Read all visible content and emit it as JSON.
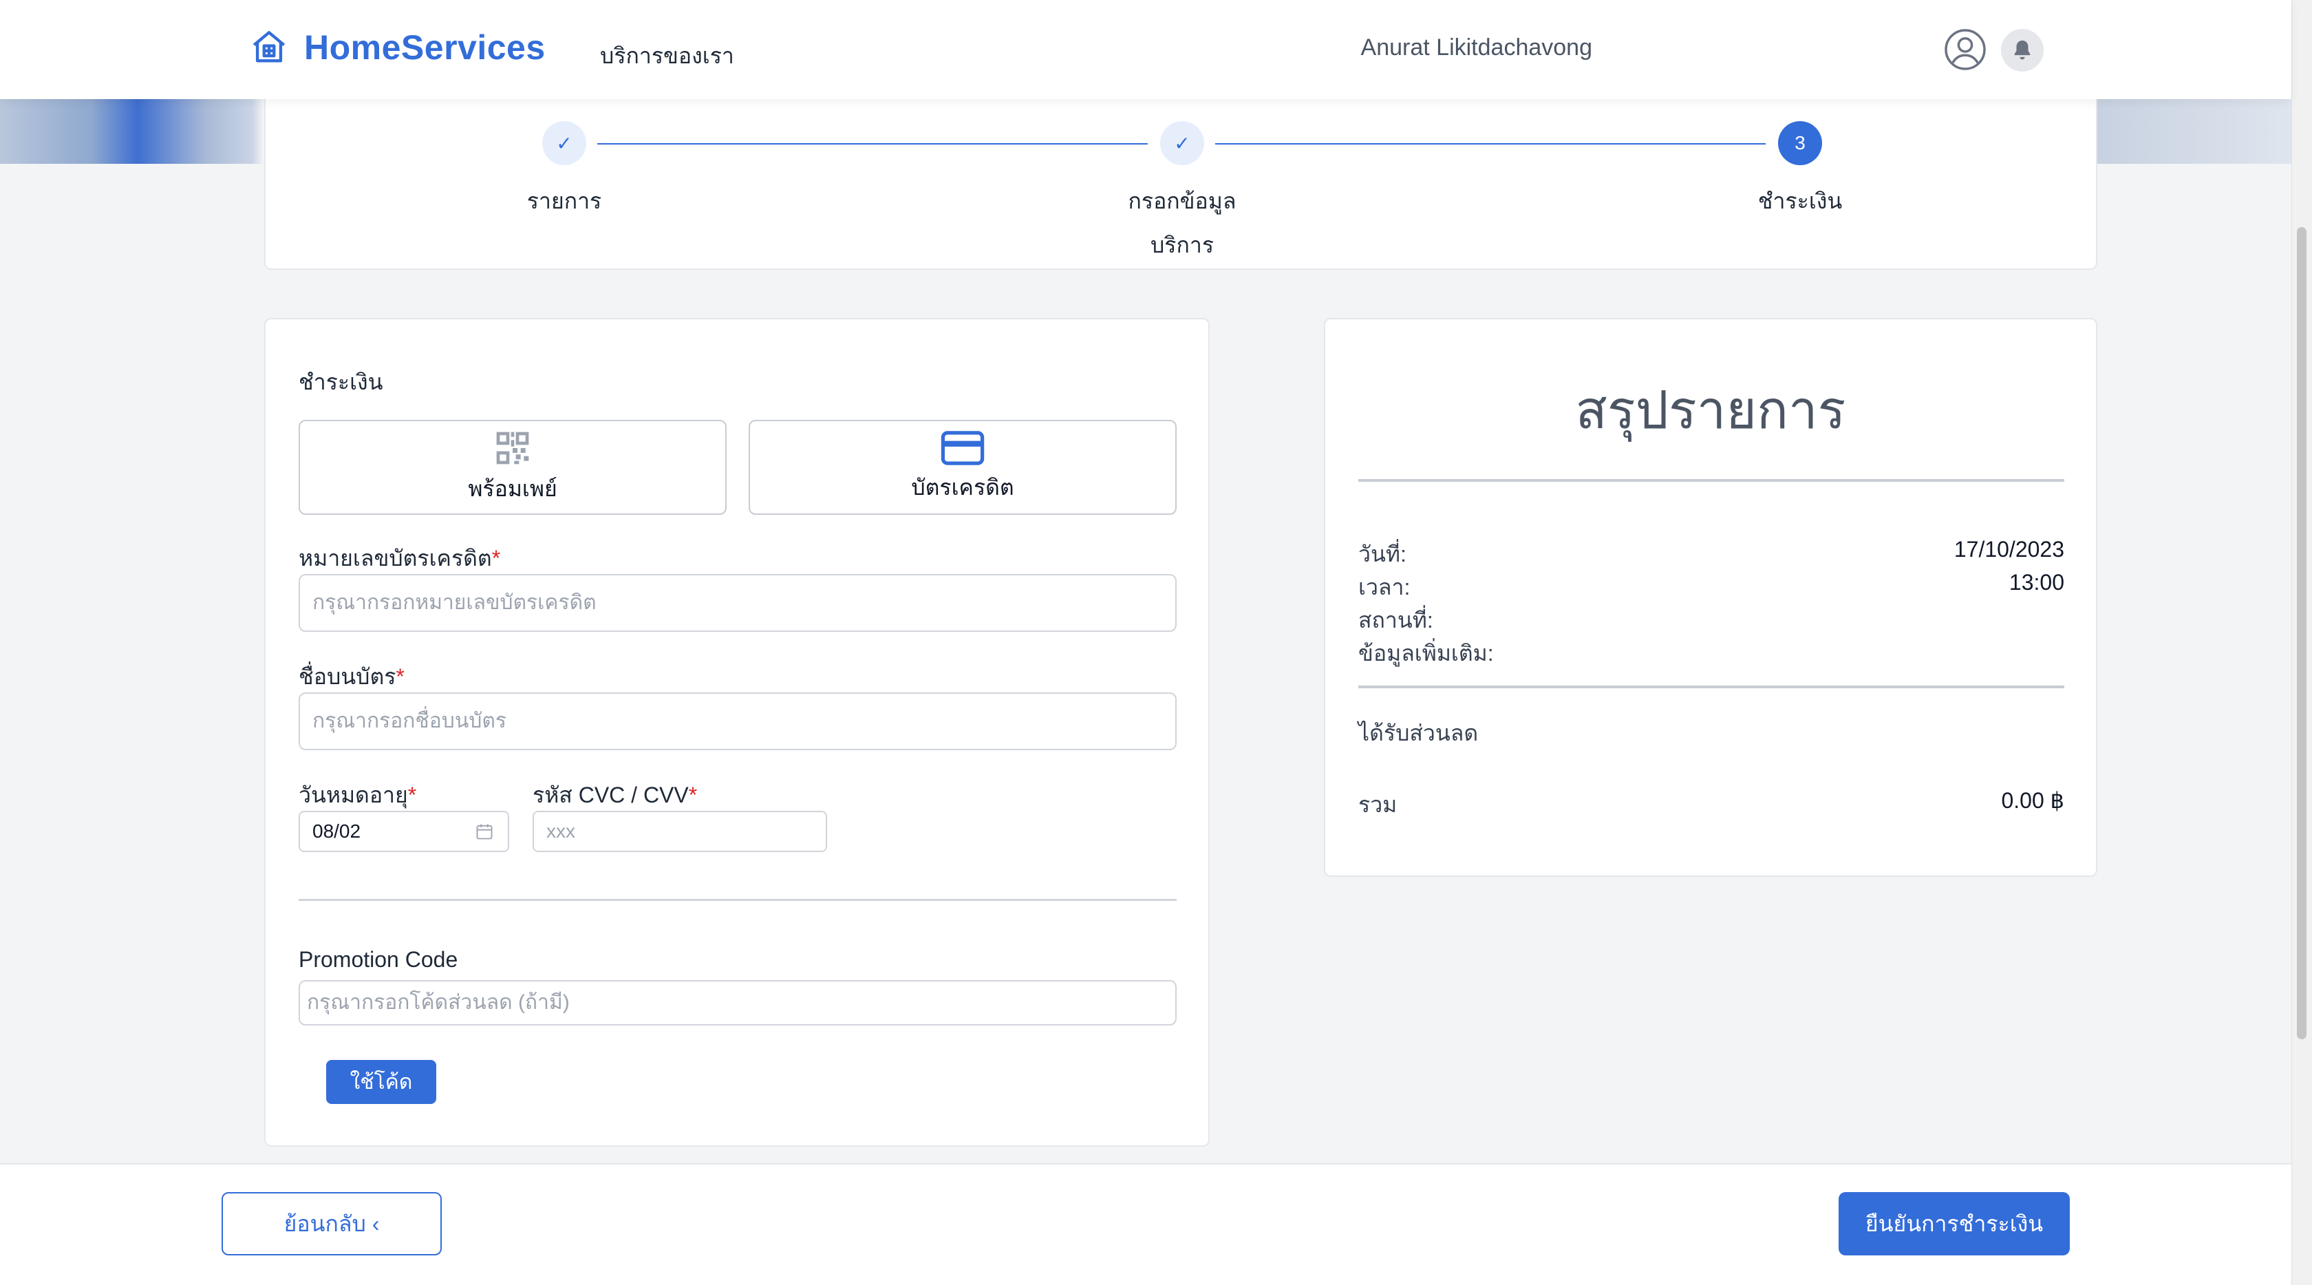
{
  "app": {
    "name": "HomeServices"
  },
  "nav": {
    "services_link": "บริการของเรา",
    "user_name": "Anurat Likitdachavong"
  },
  "stepper": {
    "steps": [
      {
        "label": "รายการ",
        "state": "done",
        "marker": "✓"
      },
      {
        "label": "กรอกข้อมูล\nบริการ",
        "state": "done",
        "marker": "✓"
      },
      {
        "label": "ชำระเงิน",
        "state": "active",
        "marker": "3"
      }
    ]
  },
  "payment": {
    "section_title": "ชำระเงิน",
    "methods": [
      {
        "label": "พร้อมเพย์",
        "icon": "qr-code-icon"
      },
      {
        "label": "บัตรเครดิต",
        "icon": "credit-card-icon"
      }
    ],
    "card_number": {
      "label": "หมายเลขบัตรเครดิต",
      "required": "*",
      "placeholder": "กรุณากรอกหมายเลขบัตรเครดิต",
      "value": ""
    },
    "card_name": {
      "label": "ชื่อบนบัตร",
      "required": "*",
      "placeholder": "กรุณากรอกชื่อบนบัตร",
      "value": ""
    },
    "expiry": {
      "label": "วันหมดอายุ",
      "required": "*",
      "value": "08/02"
    },
    "cvc": {
      "label": "รหัส CVC / CVV",
      "required": "*",
      "placeholder": "xxx",
      "value": ""
    },
    "promo": {
      "label": "Promotion Code",
      "placeholder": "กรุณากรอกโค้ดส่วนลด (ถ้ามี)",
      "button": "ใช้โค้ด"
    }
  },
  "summary": {
    "title": "สรุปรายการ",
    "date": {
      "label": "วันที่:",
      "value": "17/10/2023"
    },
    "time": {
      "label": "เวลา:",
      "value": "13:00"
    },
    "location": {
      "label": "สถานที่:",
      "value": ""
    },
    "extra": {
      "label": "ข้อมูลเพิ่มเติม:",
      "value": ""
    },
    "discount": {
      "label": "ได้รับส่วนลด"
    },
    "total": {
      "label": "รวม",
      "value": "0.00 ฿"
    }
  },
  "footer": {
    "back": "ย้อนกลับ ‹",
    "confirm": "ยืนยันการชำระเงิน"
  },
  "colors": {
    "primary": "#336dd9",
    "required": "#dc2626",
    "page_bg": "#f3f4f6"
  }
}
